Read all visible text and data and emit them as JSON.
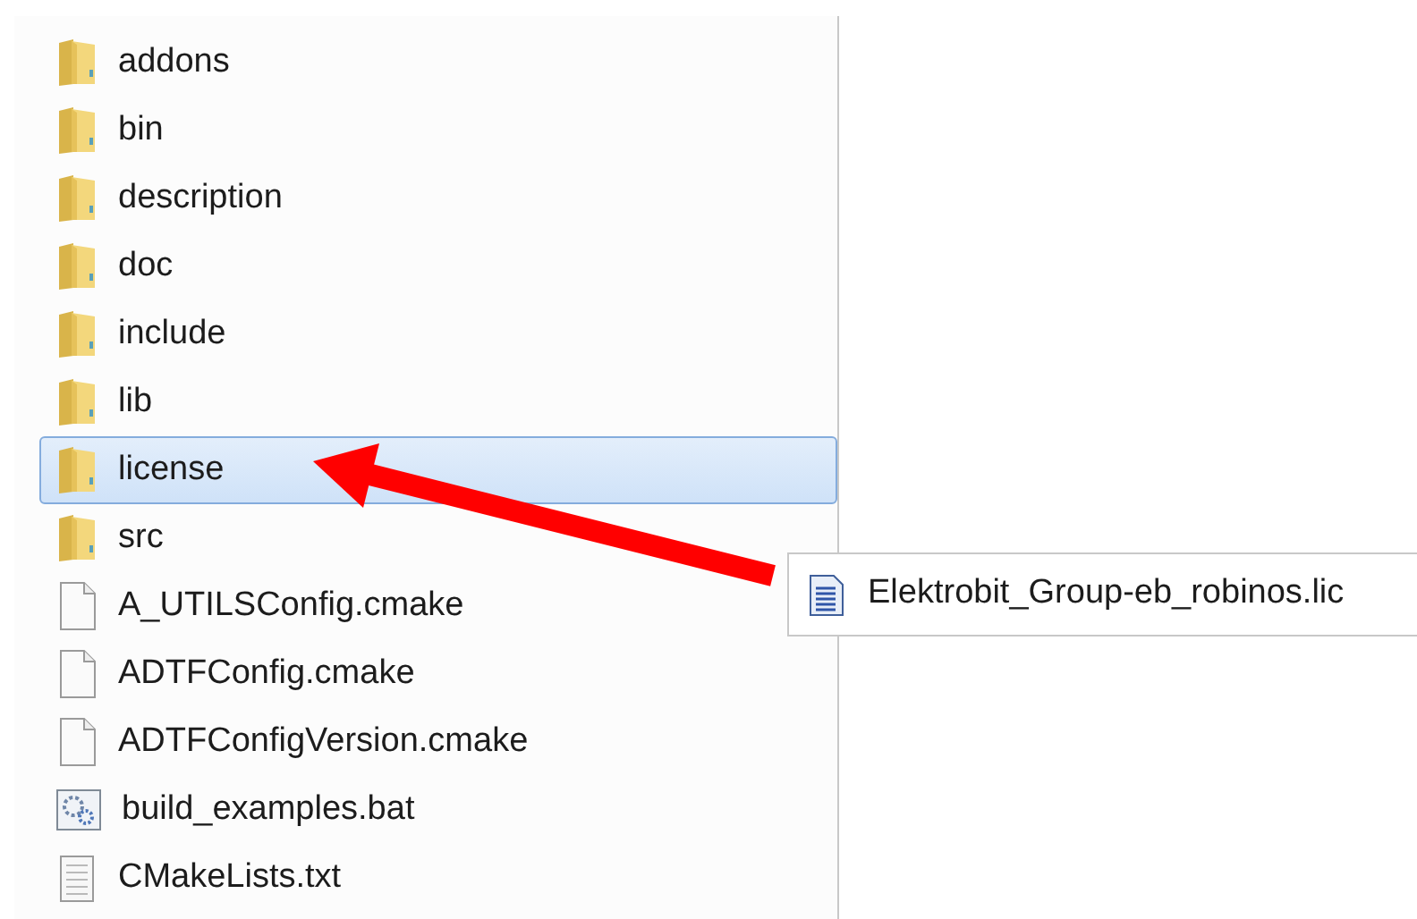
{
  "file_list": {
    "items": [
      {
        "name": "addons",
        "kind": "folder",
        "selected": false
      },
      {
        "name": "bin",
        "kind": "folder",
        "selected": false
      },
      {
        "name": "description",
        "kind": "folder",
        "selected": false
      },
      {
        "name": "doc",
        "kind": "folder",
        "selected": false
      },
      {
        "name": "include",
        "kind": "folder",
        "selected": false
      },
      {
        "name": "lib",
        "kind": "folder",
        "selected": false
      },
      {
        "name": "license",
        "kind": "folder",
        "selected": true
      },
      {
        "name": "src",
        "kind": "folder",
        "selected": false
      },
      {
        "name": "A_UTILSConfig.cmake",
        "kind": "file",
        "selected": false
      },
      {
        "name": "ADTFConfig.cmake",
        "kind": "file",
        "selected": false
      },
      {
        "name": "ADTFConfigVersion.cmake",
        "kind": "file",
        "selected": false
      },
      {
        "name": "build_examples.bat",
        "kind": "batch",
        "selected": false
      },
      {
        "name": "CMakeLists.txt",
        "kind": "text",
        "selected": false
      }
    ]
  },
  "license_folder": {
    "items": [
      {
        "name": "Elektrobit_Group-eb_robinos.lic",
        "kind": "document",
        "selected": false
      }
    ]
  }
}
